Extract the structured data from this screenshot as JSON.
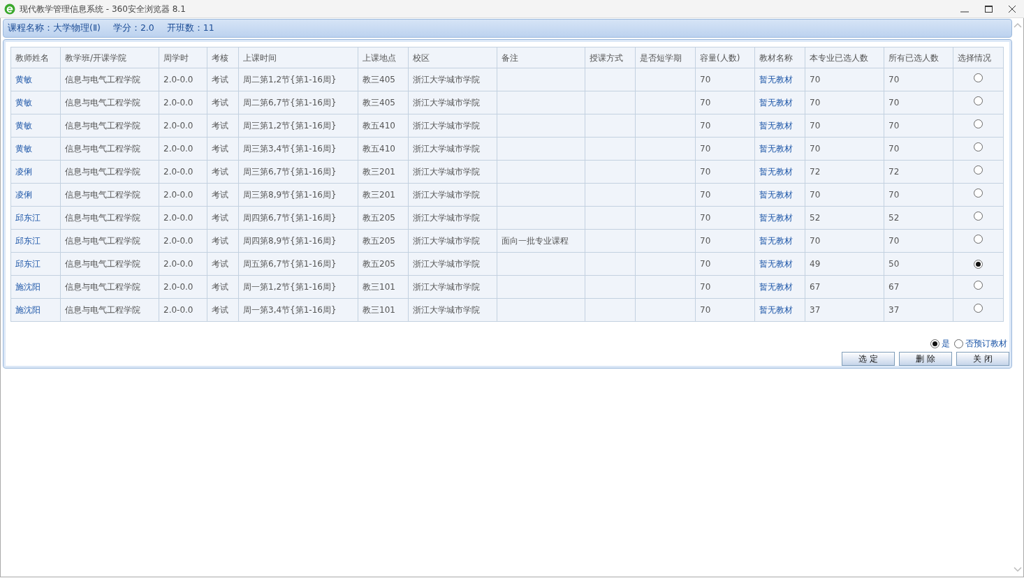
{
  "window": {
    "title": "现代教学管理信息系统 - 360安全浏览器 8.1"
  },
  "course_info": [
    "课程名称：大学物理(Ⅱ)",
    "学分：2.0",
    "开班数：11"
  ],
  "table": {
    "columns": [
      "教师姓名",
      "教学班/开课学院",
      "周学时",
      "考核",
      "上课时间",
      "上课地点",
      "校区",
      "备注",
      "授课方式",
      "是否短学期",
      "容量(人数)",
      "教材名称",
      "本专业已选人数",
      "所有已选人数",
      "选择情况"
    ],
    "rows": [
      {
        "teacher": "黄敏",
        "college": "信息与电气工程学院",
        "hours": "2.0-0.0",
        "assessment": "考试",
        "time": "周二第1,2节{第1-16周}",
        "location": "教三405",
        "campus": "浙江大学城市学院",
        "remark": "",
        "capacity": "70",
        "textbook": "暂无教材",
        "major_selected": "70",
        "all_selected": "70",
        "selected": false
      },
      {
        "teacher": "黄敏",
        "college": "信息与电气工程学院",
        "hours": "2.0-0.0",
        "assessment": "考试",
        "time": "周二第6,7节{第1-16周}",
        "location": "教三405",
        "campus": "浙江大学城市学院",
        "remark": "",
        "capacity": "70",
        "textbook": "暂无教材",
        "major_selected": "70",
        "all_selected": "70",
        "selected": false
      },
      {
        "teacher": "黄敏",
        "college": "信息与电气工程学院",
        "hours": "2.0-0.0",
        "assessment": "考试",
        "time": "周三第1,2节{第1-16周}",
        "location": "教五410",
        "campus": "浙江大学城市学院",
        "remark": "",
        "capacity": "70",
        "textbook": "暂无教材",
        "major_selected": "70",
        "all_selected": "70",
        "selected": false
      },
      {
        "teacher": "黄敏",
        "college": "信息与电气工程学院",
        "hours": "2.0-0.0",
        "assessment": "考试",
        "time": "周三第3,4节{第1-16周}",
        "location": "教五410",
        "campus": "浙江大学城市学院",
        "remark": "",
        "capacity": "70",
        "textbook": "暂无教材",
        "major_selected": "70",
        "all_selected": "70",
        "selected": false
      },
      {
        "teacher": "凌俐",
        "college": "信息与电气工程学院",
        "hours": "2.0-0.0",
        "assessment": "考试",
        "time": "周三第6,7节{第1-16周}",
        "location": "教三201",
        "campus": "浙江大学城市学院",
        "remark": "",
        "capacity": "70",
        "textbook": "暂无教材",
        "major_selected": "72",
        "all_selected": "72",
        "selected": false
      },
      {
        "teacher": "凌俐",
        "college": "信息与电气工程学院",
        "hours": "2.0-0.0",
        "assessment": "考试",
        "time": "周三第8,9节{第1-16周}",
        "location": "教三201",
        "campus": "浙江大学城市学院",
        "remark": "",
        "capacity": "70",
        "textbook": "暂无教材",
        "major_selected": "70",
        "all_selected": "70",
        "selected": false
      },
      {
        "teacher": "邱东江",
        "college": "信息与电气工程学院",
        "hours": "2.0-0.0",
        "assessment": "考试",
        "time": "周四第6,7节{第1-16周}",
        "location": "教五205",
        "campus": "浙江大学城市学院",
        "remark": "",
        "capacity": "70",
        "textbook": "暂无教材",
        "major_selected": "52",
        "all_selected": "52",
        "selected": false
      },
      {
        "teacher": "邱东江",
        "college": "信息与电气工程学院",
        "hours": "2.0-0.0",
        "assessment": "考试",
        "time": "周四第8,9节{第1-16周}",
        "location": "教五205",
        "campus": "浙江大学城市学院",
        "remark": "面向一批专业课程",
        "capacity": "70",
        "textbook": "暂无教材",
        "major_selected": "70",
        "all_selected": "70",
        "selected": false
      },
      {
        "teacher": "邱东江",
        "college": "信息与电气工程学院",
        "hours": "2.0-0.0",
        "assessment": "考试",
        "time": "周五第6,7节{第1-16周}",
        "location": "教五205",
        "campus": "浙江大学城市学院",
        "remark": "",
        "capacity": "70",
        "textbook": "暂无教材",
        "major_selected": "49",
        "all_selected": "50",
        "selected": true
      },
      {
        "teacher": "施沈阳",
        "college": "信息与电气工程学院",
        "hours": "2.0-0.0",
        "assessment": "考试",
        "time": "周一第1,2节{第1-16周}",
        "location": "教三101",
        "campus": "浙江大学城市学院",
        "remark": "",
        "capacity": "70",
        "textbook": "暂无教材",
        "major_selected": "67",
        "all_selected": "67",
        "selected": false
      },
      {
        "teacher": "施沈阳",
        "college": "信息与电气工程学院",
        "hours": "2.0-0.0",
        "assessment": "考试",
        "time": "周一第3,4节{第1-16周}",
        "location": "教三101",
        "campus": "浙江大学城市学院",
        "remark": "",
        "capacity": "70",
        "textbook": "暂无教材",
        "major_selected": "37",
        "all_selected": "37",
        "selected": false
      }
    ]
  },
  "textbook_order": [
    {
      "label": "是",
      "selected": true
    },
    {
      "label": "否预订教材",
      "selected": false
    }
  ],
  "buttons": [
    "选 定",
    "删 除",
    "关 闭"
  ]
}
